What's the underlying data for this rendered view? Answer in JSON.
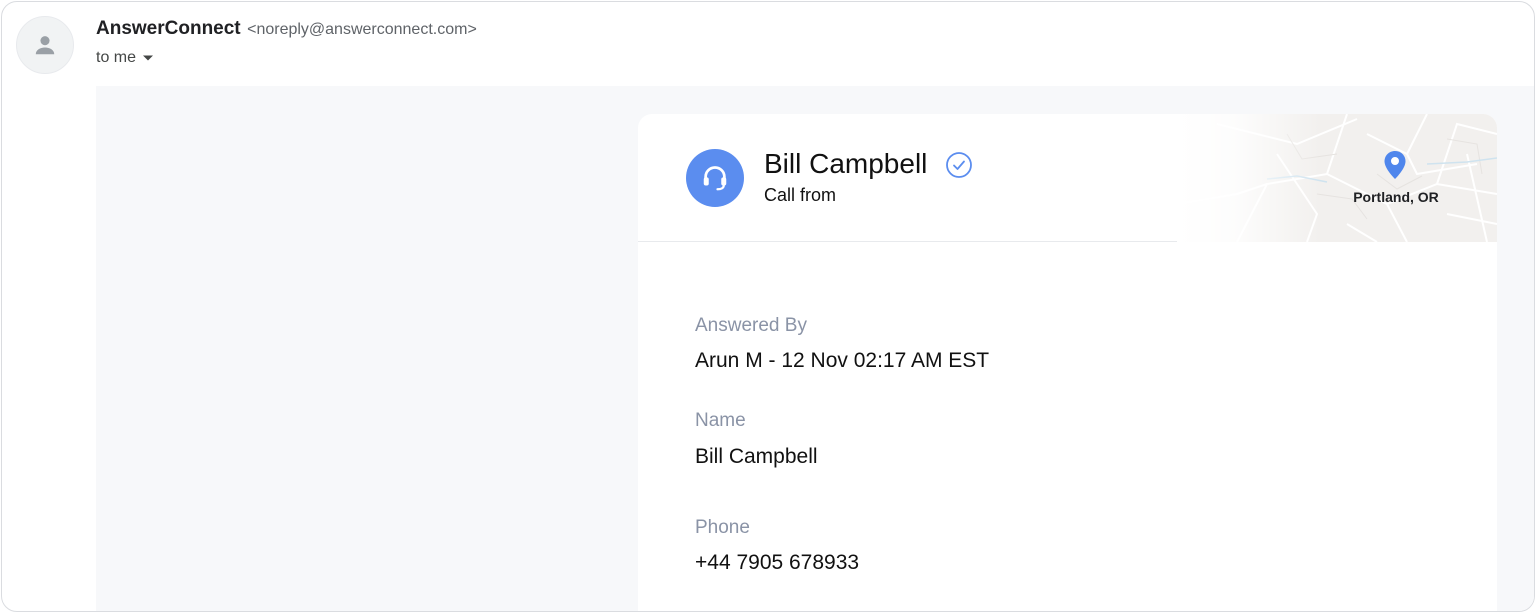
{
  "email": {
    "sender_name": "AnswerConnect",
    "sender_email": "<noreply@answerconnect.com>",
    "recipient_label": "to me"
  },
  "card": {
    "caller_name": "Bill Campbell",
    "subtitle": "Call from",
    "location": "Portland, OR",
    "fields": [
      {
        "label": "Answered By",
        "value": "Arun M - 12 Nov 02:17 AM EST"
      },
      {
        "label": "Name",
        "value": "Bill Campbell"
      },
      {
        "label": "Phone",
        "value": "+44 7905 678933"
      }
    ]
  },
  "icons": {
    "avatar": "person-icon",
    "recipients_toggle": "caret-down-icon",
    "agent": "headset-icon",
    "verified": "check-circle-icon",
    "location": "map-pin-icon"
  },
  "colors": {
    "accent": "#5b8def",
    "label": "#8a93a6",
    "body_background": "#f7f8fa"
  }
}
